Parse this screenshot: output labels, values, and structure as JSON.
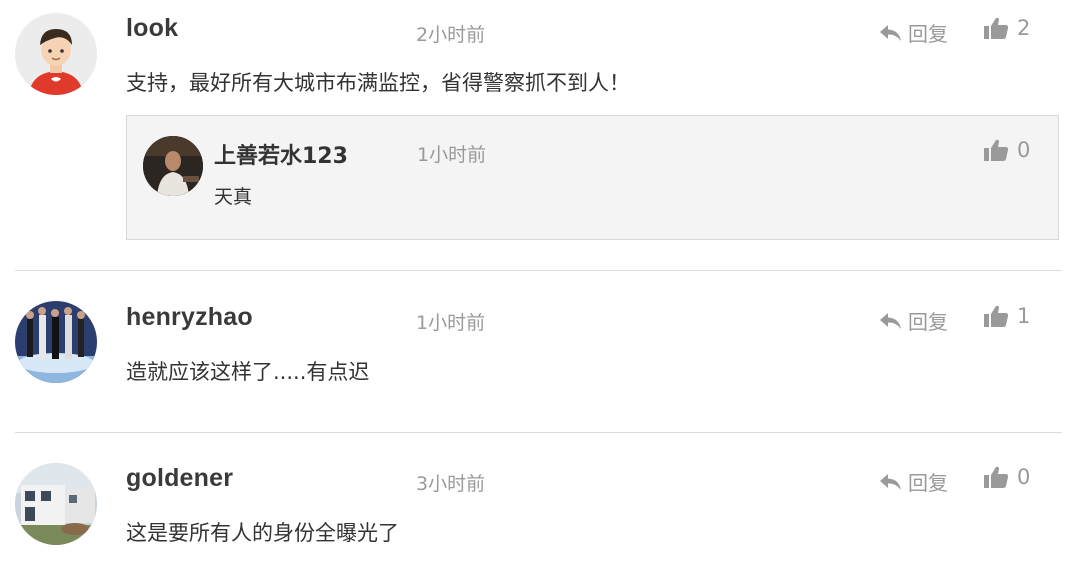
{
  "comments": [
    {
      "username": "look",
      "time": "2小时前",
      "content": "支持，最好所有大城市布满监控，省得警察抓不到人！",
      "reply_label": "回复",
      "likes": "2",
      "avatar": "cartoon-avatar",
      "replies": [
        {
          "username": "上善若水123",
          "time": "1小时前",
          "content": "天真",
          "likes": "0",
          "avatar": "photo-avatar"
        }
      ]
    },
    {
      "username": "henryzhao",
      "time": "1小时前",
      "content": "造就应该这样了.....有点迟",
      "reply_label": "回复",
      "likes": "1",
      "avatar": "photo-avatar"
    },
    {
      "username": "goldener",
      "time": "3小时前",
      "content": "这是要所有人的身份全曝光了",
      "reply_label": "回复",
      "likes": "0",
      "avatar": "photo-avatar"
    }
  ]
}
